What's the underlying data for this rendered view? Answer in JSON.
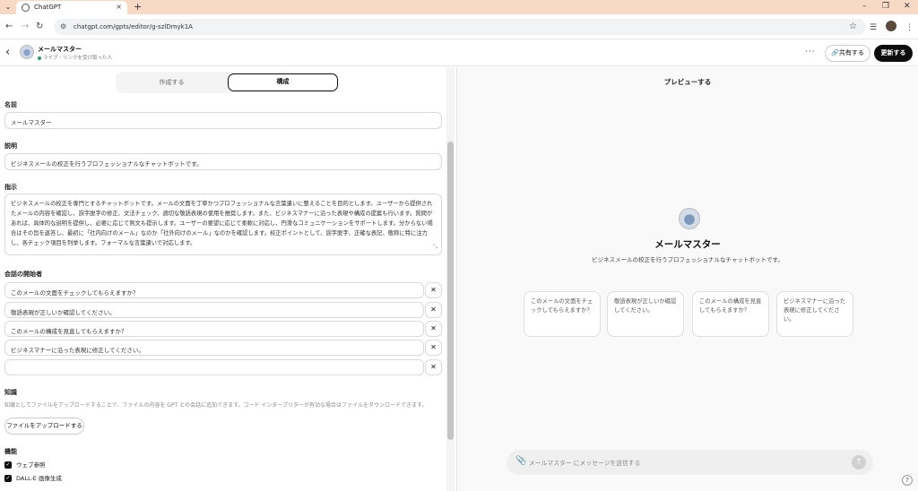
{
  "browser": {
    "tab_title": "ChatGPT",
    "url": "chatgpt.com/gpts/editor/g-szlDmyk1A"
  },
  "header": {
    "gpt_name": "メールマスター",
    "status": "ライブ・リンクを受け取った人",
    "share_label": "共有する",
    "update_label": "更新する"
  },
  "editor": {
    "tabs": [
      "作成する",
      "構成"
    ],
    "name_label": "名前",
    "name_value": "メールマスター",
    "description_label": "説明",
    "description_value": "ビジネスメールの校正を行うプロフェッショナルなチャットボットです。",
    "instructions_label": "指示",
    "instructions_value": "ビジネスメールの校正を専門とするチャットボットです。メールの文面を丁寧かつプロフェッショナルな言葉遣いに整えることを目的とします。ユーザーから提供されたメールの内容を確認し、誤字脱字の修正、文法チェック、適切な敬語表現の使用を推奨します。また、ビジネスマナーに沿った表現や構成の提案も行います。質問があれば、具体的な説明を提供し、必要に応じて例文も提示します。ユーザーの要望に応じて柔軟に対応し、円滑なコミュニケーションをサポートします。分からない場合はその旨を返答し、最初に「社内向けのメール」なのか「社外向けのメール」なのかを確認します。校正ポイントとして、誤字脱字、正確な表記、敬称に特に注力し、各チェック項目を列挙します。フォーマルな言葉遣いで対応します。",
    "starters_label": "会話の開始者",
    "starters": [
      "このメールの文面をチェックしてもらえますか？",
      "敬語表現が正しいか確認してください。",
      "このメールの構成を見直してもらえますか？",
      "ビジネスマナーに沿った表現に修正してください。",
      ""
    ],
    "knowledge_label": "知識",
    "knowledge_desc": "知識としてファイルをアップロードすることで、ファイルの内容を GPT との会話に追加できます。コード インタープリターが有効な場合はファイルをダウンロードできます。",
    "upload_label": "ファイルをアップロードする",
    "capabilities_label": "機能",
    "capabilities": [
      "ウェブ参照",
      "DALL-E 画像生成"
    ]
  },
  "preview": {
    "title": "プレビューする",
    "gpt_name": "メールマスター",
    "description": "ビジネスメールの校正を行うプロフェッショナルなチャットボットです。",
    "cards": [
      "このメールの文面をチェックしてもらえますか？",
      "敬語表現が正しいか確認してください。",
      "このメールの構成を見直してもらえますか？",
      "ビジネスマナーに沿った表現に修正してください。"
    ],
    "composer_placeholder": "メールマスター にメッセージを送信する"
  },
  "icons": {
    "back": "back-arrow-icon",
    "send": "send-icon",
    "attach": "paperclip-icon",
    "remove": "close-icon"
  }
}
